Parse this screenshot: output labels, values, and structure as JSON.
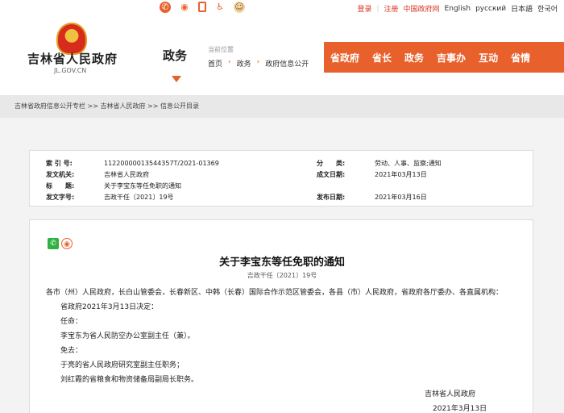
{
  "topbar": {
    "icons": [
      "wechat-icon",
      "weibo-icon",
      "mobile-icon",
      "accessibility-icon",
      "mascot-icon"
    ],
    "links": [
      "登录",
      "注册",
      "中国政府网",
      "English",
      "русский",
      "日本語",
      "한국어"
    ]
  },
  "header": {
    "site_name": "吉林省人民政府",
    "site_url": "JL.GOV.CN",
    "section": "政务",
    "location_label": "当前位置",
    "location": [
      "首页",
      "政务",
      "政府信息公开"
    ],
    "nav": [
      "省政府",
      "省长",
      "政务",
      "吉事办",
      "互动",
      "省情"
    ]
  },
  "breadcrumb": "吉林省政府信息公开专栏 >> 吉林省人民政府 >> 信息公开目录",
  "meta": {
    "index_label": "索 引 号:",
    "index_value": "11220000013544357T/2021-01369",
    "category_label": "分　　类:",
    "category_value": "劳动、人事、监察;通知",
    "issuer_label": "发文机关:",
    "issuer_value": "吉林省人民政府",
    "created_label": "成文日期:",
    "created_value": "2021年03月13日",
    "title_label": "标　　题:",
    "title_value": "关于李宝东等任免职的通知",
    "docno_label": "发文字号:",
    "docno_value": "吉政干任〔2021〕19号",
    "published_label": "发布日期:",
    "published_value": "2021年03月16日"
  },
  "article": {
    "title": "关于李宝东等任免职的通知",
    "doc_number": "吉政干任〔2021〕19号",
    "recipients": "各市（州）人民政府，长白山管委会，长春新区、中韩（长春）国际合作示范区管委会，各县（市）人民政府，省政府各厅委办、各直属机构：",
    "line1": "省政府2021年3月13日决定：",
    "line2": "任命：",
    "line3": "李宝东为省人民防空办公室副主任（兼）。",
    "line4": "免去：",
    "line5": "于亮的省人民政府研究室副主任职务；",
    "line6": "刘红霞的省粮食和物资储备局副局长职务。",
    "signer": "吉林省人民政府",
    "date": "2021年3月13日"
  }
}
